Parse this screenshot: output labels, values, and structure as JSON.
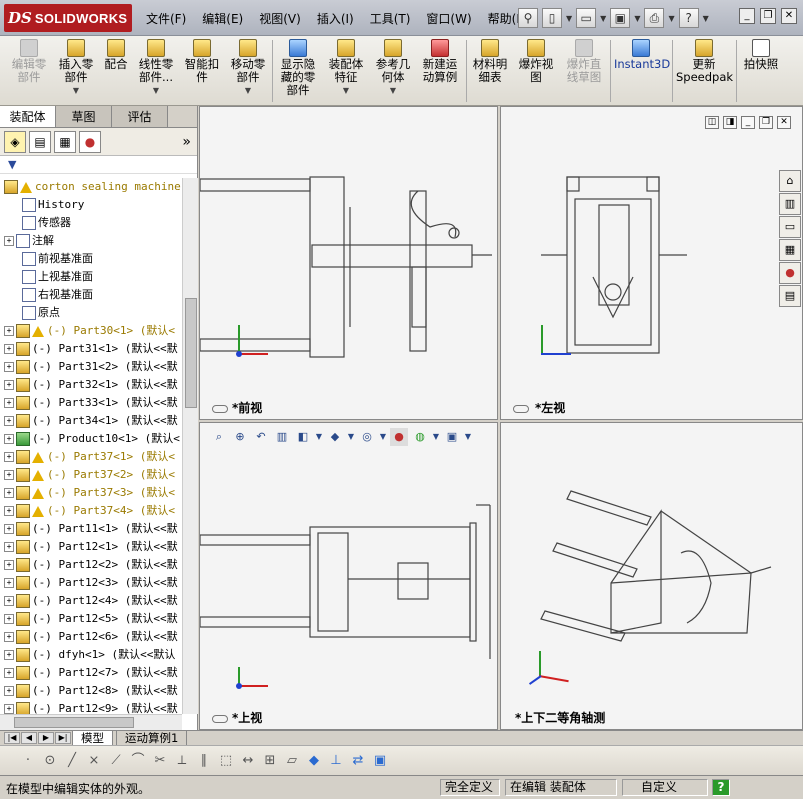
{
  "app": {
    "logo_ds": "DS",
    "logo_text": "SOLIDWORKS"
  },
  "menu": [
    "文件(F)",
    "编辑(E)",
    "视图(V)",
    "插入(I)",
    "工具(T)",
    "窗口(W)",
    "帮助(H)"
  ],
  "command_manager": [
    {
      "label": "编辑零\n部件",
      "icon": "edit-part-icon",
      "enabled": false
    },
    {
      "label": "插入零\n部件",
      "icon": "insert-component-icon",
      "enabled": true
    },
    {
      "label": "配合",
      "icon": "mate-icon",
      "enabled": true
    },
    {
      "label": "线性零\n部件...",
      "icon": "linear-pattern-icon",
      "enabled": true
    },
    {
      "label": "智能扣\n件",
      "icon": "smart-fastener-icon",
      "enabled": true
    },
    {
      "label": "移动零\n部件",
      "icon": "move-component-icon",
      "enabled": true
    },
    {
      "label": "显示隐\n藏的零\n部件",
      "icon": "show-hidden-icon",
      "enabled": true
    },
    {
      "label": "装配体\n特征",
      "icon": "assembly-feature-icon",
      "enabled": true
    },
    {
      "label": "参考几\n何体",
      "icon": "reference-geometry-icon",
      "enabled": true
    },
    {
      "label": "新建运\n动算例",
      "icon": "motion-study-icon",
      "enabled": true
    },
    {
      "label": "材料明\n细表",
      "icon": "bom-icon",
      "enabled": true
    },
    {
      "label": "爆炸视\n图",
      "icon": "exploded-view-icon",
      "enabled": true
    },
    {
      "label": "爆炸直\n线草图",
      "icon": "explode-line-icon",
      "enabled": false
    },
    {
      "label": "Instant3D",
      "icon": "instant3d-icon",
      "enabled": true
    },
    {
      "label": "更新\nSpeedpak",
      "icon": "speedpak-icon",
      "enabled": true
    },
    {
      "label": "拍快照",
      "icon": "snapshot-icon",
      "enabled": true
    }
  ],
  "left_tabs": [
    "装配体",
    "草图",
    "评估"
  ],
  "tree": [
    {
      "text": "corton sealing machine",
      "icon": "assembly-icon",
      "warn": true,
      "style": "y",
      "pm": false
    },
    {
      "text": "History",
      "icon": "history-icon",
      "indent": true
    },
    {
      "text": "传感器",
      "icon": "sensor-icon",
      "indent": true
    },
    {
      "text": "注解",
      "icon": "annotation-icon",
      "pm": true
    },
    {
      "text": "前视基准面",
      "icon": "plane-icon",
      "indent": true
    },
    {
      "text": "上视基准面",
      "icon": "plane-icon",
      "indent": true
    },
    {
      "text": "右视基准面",
      "icon": "plane-icon",
      "indent": true
    },
    {
      "text": "原点",
      "icon": "origin-icon",
      "indent": true
    },
    {
      "text": "(-) Part30<1> (默认<",
      "warn": true,
      "style": "y",
      "pm": true
    },
    {
      "text": "(-) Part31<1> (默认<<默",
      "pm": true
    },
    {
      "text": "(-) Part31<2> (默认<<默",
      "pm": true
    },
    {
      "text": "(-) Part32<1> (默认<<默",
      "pm": true
    },
    {
      "text": "(-) Part33<1> (默认<<默",
      "pm": true
    },
    {
      "text": "(-) Part34<1> (默认<<默",
      "pm": true
    },
    {
      "text": "(-) Product10<1> (默认<",
      "pm": true,
      "icon": "green"
    },
    {
      "text": "(-) Part37<1> (默认<",
      "warn": true,
      "style": "y",
      "pm": true
    },
    {
      "text": "(-) Part37<2> (默认<",
      "warn": true,
      "style": "y",
      "pm": true
    },
    {
      "text": "(-) Part37<3> (默认<",
      "warn": true,
      "style": "y",
      "pm": true
    },
    {
      "text": "(-) Part37<4> (默认<",
      "warn": true,
      "style": "y",
      "pm": true
    },
    {
      "text": "(-) Part11<1> (默认<<默",
      "pm": true
    },
    {
      "text": "(-) Part12<1> (默认<<默",
      "pm": true
    },
    {
      "text": "(-) Part12<2> (默认<<默",
      "pm": true
    },
    {
      "text": "(-) Part12<3> (默认<<默",
      "pm": true
    },
    {
      "text": "(-) Part12<4> (默认<<默",
      "pm": true
    },
    {
      "text": "(-) Part12<5> (默认<<默",
      "pm": true
    },
    {
      "text": "(-) Part12<6> (默认<<默",
      "pm": true
    },
    {
      "text": "(-) dfyh<1> (默认<<默认",
      "pm": true
    },
    {
      "text": "(-) Part12<7> (默认<<默",
      "pm": true
    },
    {
      "text": "(-) Part12<8> (默认<<默",
      "pm": true
    },
    {
      "text": "(-) Part12<9> (默认<<默",
      "pm": true
    }
  ],
  "viewports": {
    "front": "*前视",
    "left": "*左视",
    "top": "*上视",
    "iso": "*上下二等角轴测"
  },
  "bottom_tabs": [
    "模型",
    "运动算例1"
  ],
  "status": {
    "message": "在模型中编辑实体的外观。",
    "defined": "完全定义",
    "editing": "在编辑 装配体",
    "units": "自定义",
    "help": "?"
  }
}
